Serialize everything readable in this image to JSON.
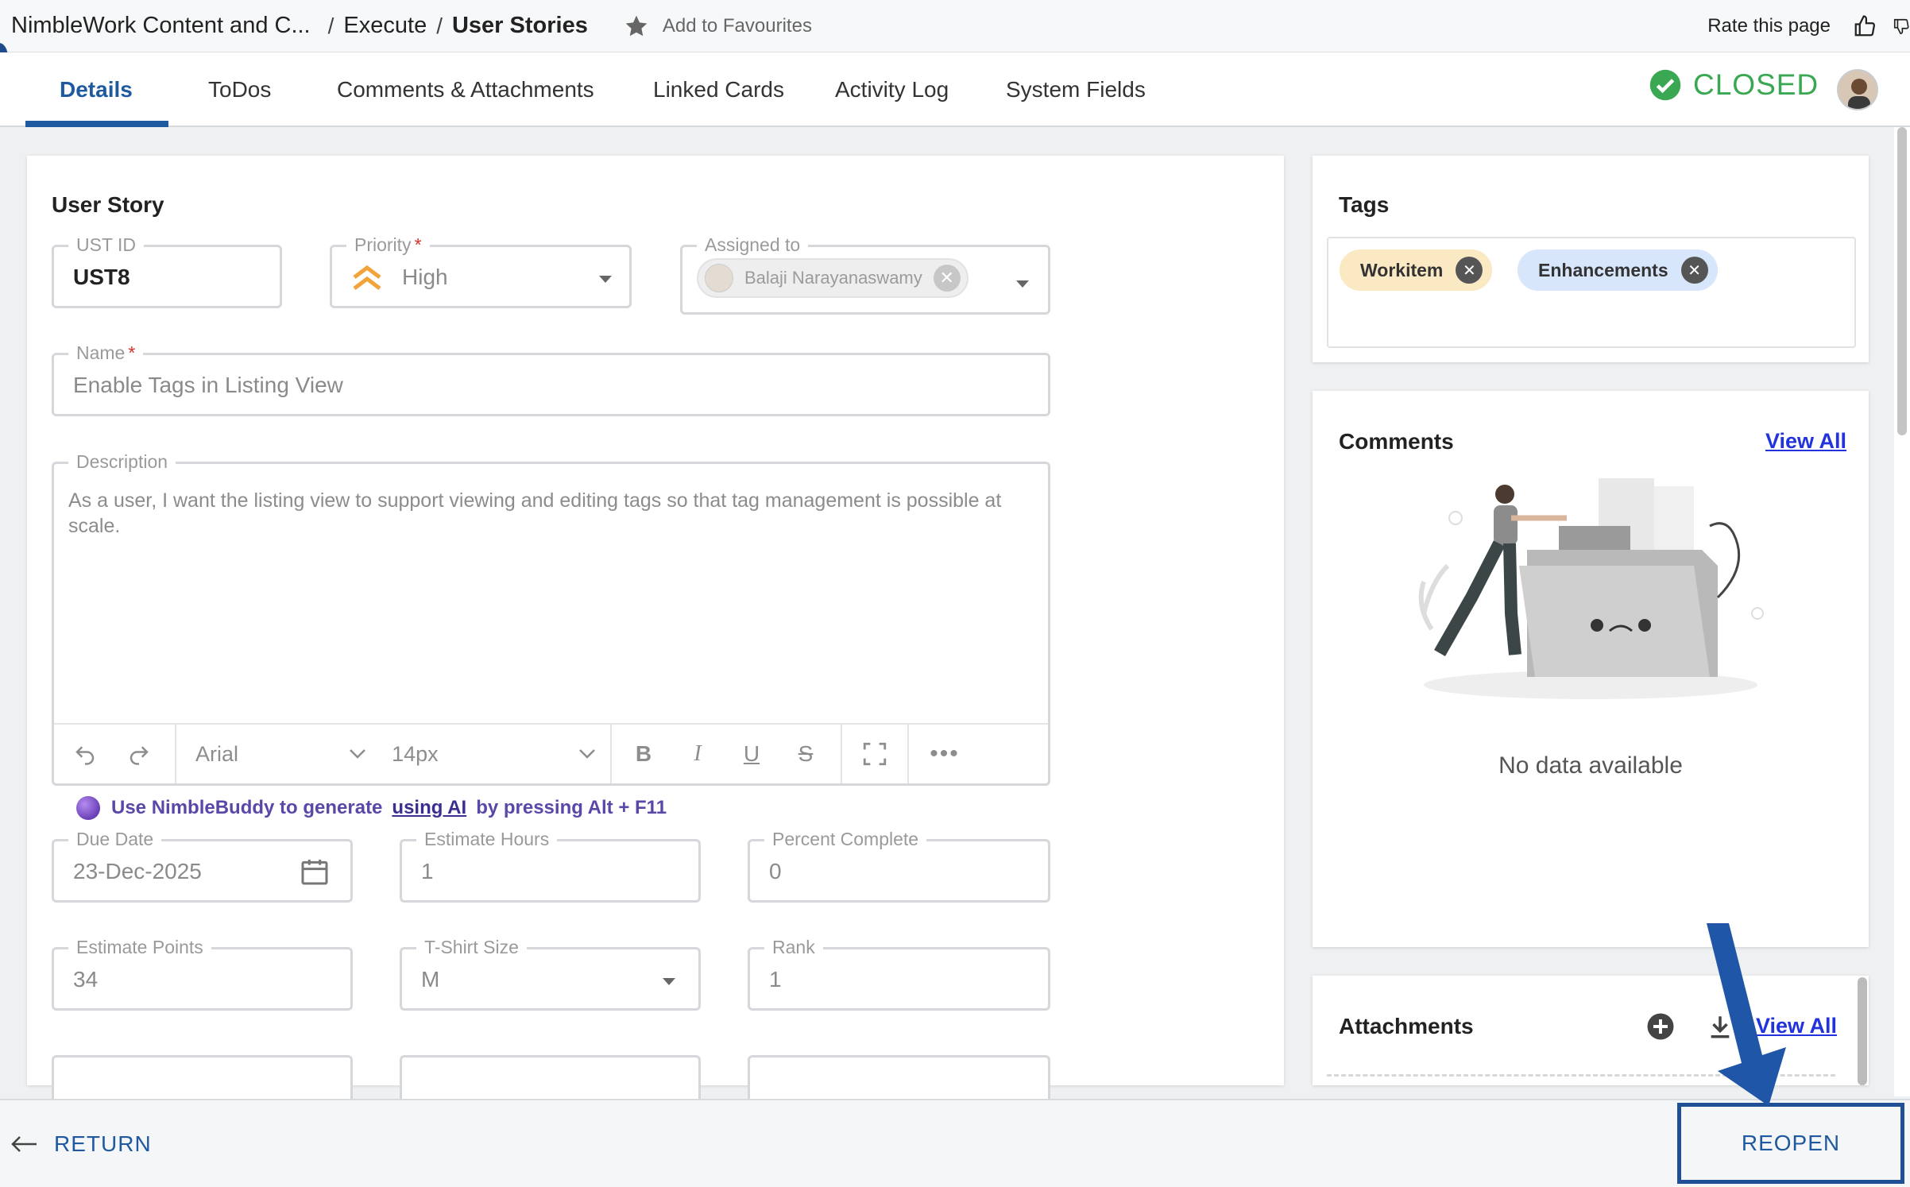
{
  "breadcrumb": {
    "project": "NimbleWork Content and C...",
    "section": "Execute",
    "current": "User Stories",
    "separator": "/"
  },
  "favourites_label": "Add to Favourites",
  "rate_label": "Rate this page",
  "tabs": [
    {
      "label": "Details",
      "active": true
    },
    {
      "label": "ToDos"
    },
    {
      "label": "Comments & Attachments"
    },
    {
      "label": "Linked Cards"
    },
    {
      "label": "Activity Log"
    },
    {
      "label": "System Fields"
    }
  ],
  "status": {
    "label": "CLOSED",
    "color": "#3aa853"
  },
  "form": {
    "section_title": "User Story",
    "ust_id": {
      "label": "UST ID",
      "value": "UST8"
    },
    "priority": {
      "label": "Priority",
      "value": "High",
      "required": "*"
    },
    "assigned_to": {
      "label": "Assigned to",
      "value": "Balaji Narayanaswamy"
    },
    "name": {
      "label": "Name",
      "value": "Enable Tags in Listing View",
      "required": "*"
    },
    "description": {
      "label": "Description",
      "value": "As a user, I want the listing view to support viewing and editing tags so that tag management is possible at scale."
    },
    "editor": {
      "font": "Arial",
      "size": "14px"
    },
    "due_date": {
      "label": "Due Date",
      "value": "23-Dec-2025"
    },
    "estimate_hours": {
      "label": "Estimate Hours",
      "value": "1"
    },
    "percent_complete": {
      "label": "Percent Complete",
      "value": "0"
    },
    "estimate_points": {
      "label": "Estimate Points",
      "value": "34"
    },
    "tshirt_size": {
      "label": "T-Shirt Size",
      "value": "M"
    },
    "rank": {
      "label": "Rank",
      "value": "1"
    }
  },
  "nimblebuddy": {
    "prefix": "Use NimbleBuddy to generate",
    "link": "using AI",
    "suffix": "by pressing Alt + F11"
  },
  "tags_panel": {
    "title": "Tags",
    "tags": [
      {
        "label": "Workitem",
        "color": "#fbe9c4"
      },
      {
        "label": "Enhancements",
        "color": "#d7e6fb"
      }
    ]
  },
  "comments_panel": {
    "title": "Comments",
    "view_all": "View All",
    "empty": "No data available"
  },
  "attachments_panel": {
    "title": "Attachments",
    "view_all": "View All"
  },
  "footer": {
    "return_label": "RETURN",
    "reopen_label": "REOPEN"
  },
  "colors": {
    "accent": "#1f5aa0",
    "link": "#2233dd",
    "required": "#d6302b",
    "priority": "#f2a33a"
  }
}
